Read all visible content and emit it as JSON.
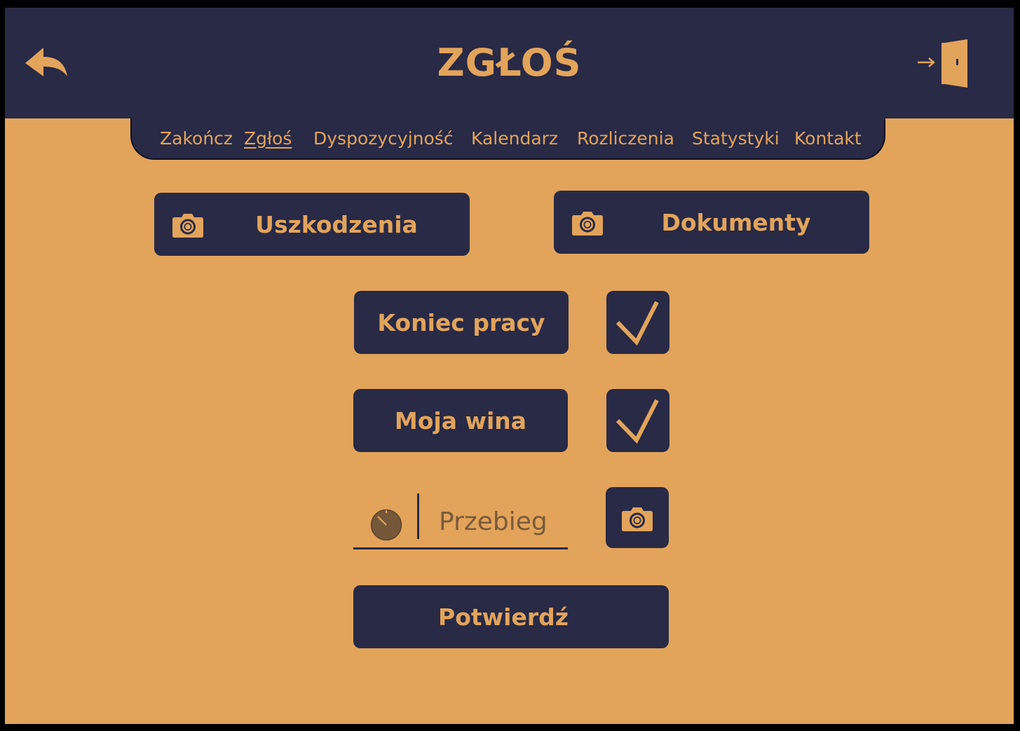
{
  "header": {
    "title": "ZGŁOŚ",
    "back_icon": "reply-arrow-icon",
    "logout_icon": "logout-door-icon"
  },
  "nav": {
    "items": [
      {
        "label": "Zakończ",
        "active": false
      },
      {
        "label": "Zgłoś",
        "active": true
      },
      {
        "label": "Dyspozycyjność",
        "active": false
      },
      {
        "label": "Kalendarz",
        "active": false
      },
      {
        "label": "Rozliczenia",
        "active": false
      },
      {
        "label": "Statystyki",
        "active": false
      },
      {
        "label": "Kontakt",
        "active": false
      }
    ]
  },
  "main": {
    "damage_button": {
      "label": "Uszkodzenia",
      "icon": "camera-icon"
    },
    "documents_button": {
      "label": "Dokumenty",
      "icon": "camera-icon"
    },
    "end_of_work": {
      "label": "Koniec pracy",
      "checked": true
    },
    "my_fault": {
      "label": "Moja wina",
      "checked": true
    },
    "mileage": {
      "placeholder": "Przebieg",
      "value": "",
      "icon": "gauge-icon"
    },
    "mileage_photo": {
      "icon": "camera-icon"
    },
    "confirm_button": {
      "label": "Potwierdź"
    }
  },
  "colors": {
    "background": "#e2a45b",
    "panel": "#282a46",
    "accent": "#e2a45b",
    "placeholder_text": "#7a5a3c"
  }
}
